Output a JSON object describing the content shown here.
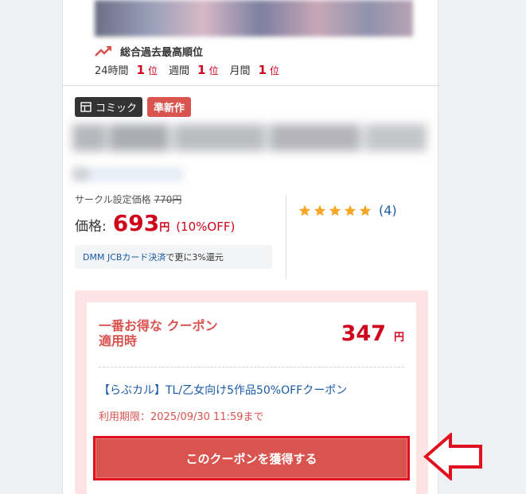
{
  "ranking": {
    "title": "総合過去最高順位",
    "items": [
      {
        "label": "24時間",
        "rank": "1",
        "unit": "位"
      },
      {
        "label": "週間",
        "rank": "1",
        "unit": "位"
      },
      {
        "label": "月間",
        "rank": "1",
        "unit": "位"
      }
    ]
  },
  "tags": {
    "category": "コミック",
    "badge": "準新作"
  },
  "price": {
    "circle_label": "サークル設定価格",
    "circle_price": "770円",
    "label": "価格:",
    "value": "693",
    "yen": "円",
    "discount": "(10%OFF)"
  },
  "jcb": {
    "link": "DMM JCBカード決済",
    "text": "で更に3%還元"
  },
  "rating": {
    "stars": 5,
    "count": "(4)"
  },
  "coupon": {
    "best_label": "一番お得な クーポン適用時",
    "price": "347",
    "yen": "円",
    "name": "【らぶカル】TL/乙女向け5作品50%OFFクーポン",
    "limit": "利用期限：2025/09/30 11:59まで",
    "button": "このクーポンを獲得する"
  },
  "colors": {
    "accent_red": "#d0021b",
    "coupon_bg": "#fde3e3",
    "button": "#d9534f",
    "link": "#1a5aa6",
    "star": "#f5a623"
  }
}
